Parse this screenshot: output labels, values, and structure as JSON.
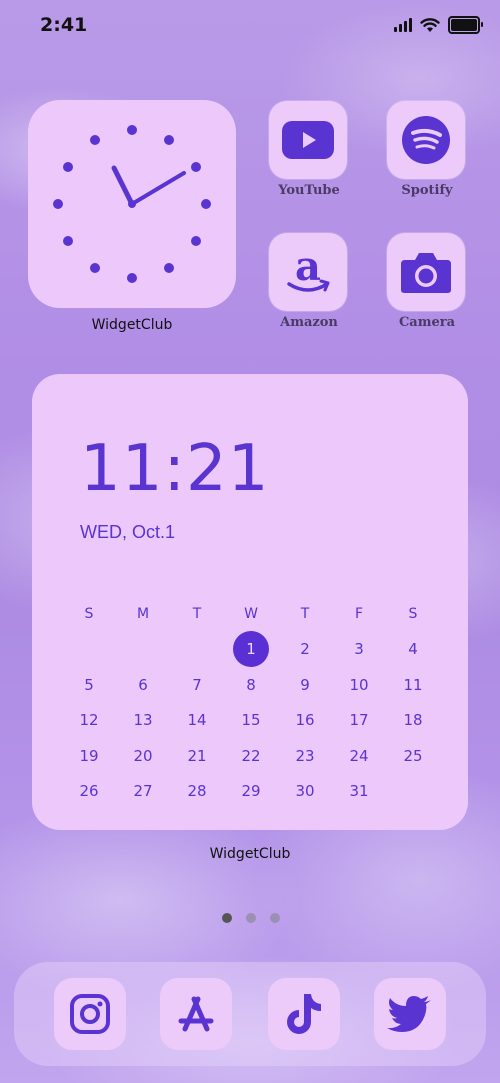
{
  "status_bar": {
    "time": "2:41"
  },
  "widgets": {
    "clock_label": "WidgetClub",
    "calendar_label": "WidgetClub"
  },
  "apps": [
    {
      "label": "YouTube",
      "icon": "youtube-icon"
    },
    {
      "label": "Spotify",
      "icon": "spotify-icon"
    },
    {
      "label": "Amazon",
      "icon": "amazon-icon"
    },
    {
      "label": "Camera",
      "icon": "camera-icon"
    }
  ],
  "calendar": {
    "time": "11:21",
    "date": "WED, Oct.1",
    "weekdays": [
      "S",
      "M",
      "T",
      "W",
      "T",
      "F",
      "S"
    ],
    "weeks": [
      [
        "",
        "",
        "",
        "1",
        "2",
        "3",
        "4"
      ],
      [
        "5",
        "6",
        "7",
        "8",
        "9",
        "10",
        "11"
      ],
      [
        "12",
        "13",
        "14",
        "15",
        "16",
        "17",
        "18"
      ],
      [
        "19",
        "20",
        "21",
        "22",
        "23",
        "24",
        "25"
      ],
      [
        "26",
        "27",
        "28",
        "29",
        "30",
        "31",
        ""
      ]
    ],
    "today": "1"
  },
  "dock": [
    {
      "icon": "instagram-icon"
    },
    {
      "icon": "app-store-icon"
    },
    {
      "icon": "tiktok-icon"
    },
    {
      "icon": "twitter-icon"
    }
  ],
  "colors": {
    "accent": "#5a34d1",
    "tile": "#ecc9fa"
  }
}
